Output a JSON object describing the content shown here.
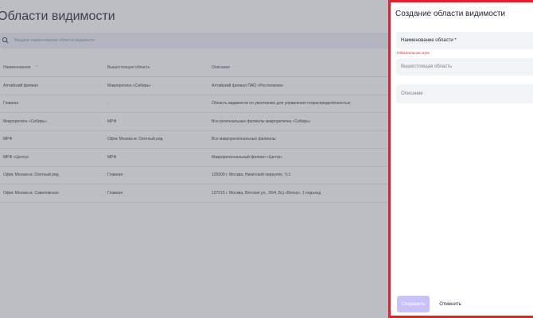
{
  "page": {
    "title": "Области видимости",
    "search": {
      "placeholder": "Введите наименование области видимости"
    }
  },
  "table": {
    "columns": [
      "Наименование",
      "Вышестоящая область",
      "Описание"
    ],
    "sort_indicator": "⌃",
    "rows": [
      [
        "Алтайский филиал",
        "Макрорегион «Сибирь»",
        "Алтайский филиал ПАО «Ростелеком»"
      ],
      [
        "Главная",
        "-",
        "Область видимости по умолчанию для управления геораспределённостью"
      ],
      [
        "Макрорегион «Сибирь»",
        "МРФ",
        "Все региональные филиалы макрорегиона «Сибирь»"
      ],
      [
        "МРФ",
        "Офис Москва м. Охотный ряд",
        "Все макрорегиональные филиалы"
      ],
      [
        "МРФ «Центр»",
        "МРФ",
        "Макрорегиональный филиал «Центр»"
      ],
      [
        "Офис Москва м. Охотный ряд",
        "Главная",
        "125009 г. Москва, Никитский переулок, 7с1"
      ],
      [
        "Офис Москва м. Савеловская",
        "Главная",
        "127015 г. Москва, Вятская ул., 35/4, БЦ «Вятка», 1 подъезд"
      ]
    ]
  },
  "drawer": {
    "title": "Создание области видимости",
    "name_label": "Наименование области *",
    "required_error": "Обязательное поле",
    "parent_placeholder": "Вышестоящая область",
    "description_placeholder": "Описание",
    "save_label": "Сохранить",
    "cancel_label": "Отменить"
  },
  "colors": {
    "highlight_border": "#e0202a",
    "save_button": "#c7c3f8",
    "error_text": "#d92d2d",
    "overlay": "#606470"
  },
  "icons": {
    "search": "search-icon"
  }
}
